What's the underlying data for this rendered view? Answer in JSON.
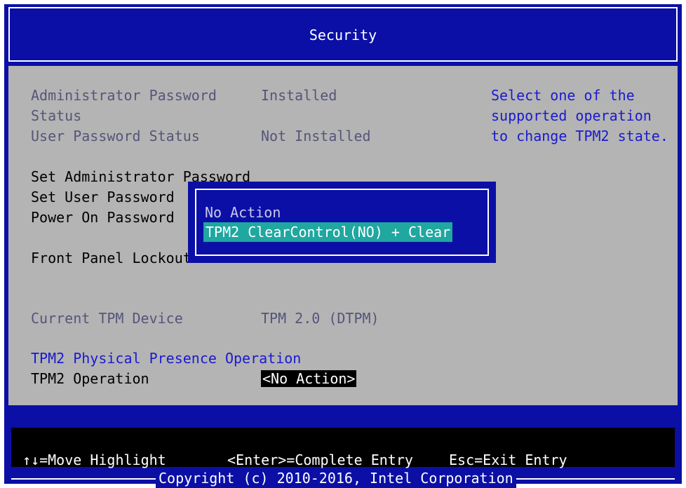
{
  "header": {
    "title": "Security"
  },
  "settings": {
    "admin_password_status_label_1": "Administrator Password",
    "admin_password_status_label_2": "Status",
    "admin_password_status_value": "Installed",
    "user_password_status_label": "User Password Status",
    "user_password_status_value": "Not Installed",
    "set_admin_password": "Set Administrator Password",
    "set_user_password": "Set User Password",
    "power_on_password": "Power On Password",
    "front_panel_lockout": "Front Panel Lockout",
    "current_tpm_device_label": "Current TPM Device",
    "current_tpm_device_value": "TPM 2.0 (DTPM)",
    "tpm2_section_heading": "TPM2 Physical Presence Operation",
    "tpm2_operation_label": "TPM2 Operation",
    "tpm2_operation_value": "<No Action>"
  },
  "help": {
    "line1": "Select one of the",
    "line2": "supported operation",
    "line3": "to change TPM2 state."
  },
  "popup": {
    "options": [
      "No Action",
      "TPM2 ClearControl(NO) + Clear"
    ],
    "selected_index": 1
  },
  "footer": {
    "move_hint": "↑↓=Move Highlight",
    "enter_hint": "<Enter>=Complete Entry",
    "esc_hint": "Esc=Exit Entry",
    "copyright": "Copyright (c) 2010-2016, Intel Corporation"
  },
  "colors": {
    "bios_blue": "#0b0fa6",
    "panel_gray": "#b4b4b4",
    "highlight_teal": "#1fa7a0",
    "help_blue": "#1a1ad0"
  }
}
